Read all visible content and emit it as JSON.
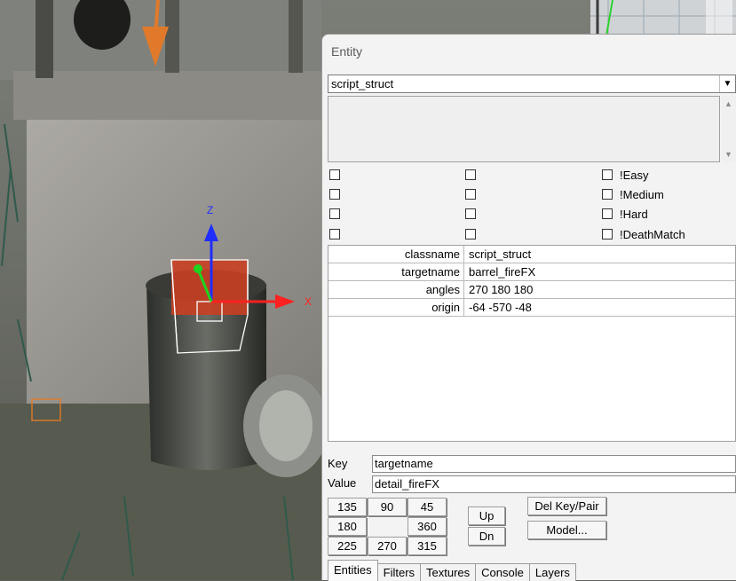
{
  "panel": {
    "title": "Entity",
    "class_select": {
      "value": "script_struct"
    },
    "flags": [
      {
        "label": ""
      },
      {
        "label": ""
      },
      {
        "label": "!Easy"
      },
      {
        "label": ""
      },
      {
        "label": ""
      },
      {
        "label": "!Medium"
      },
      {
        "label": ""
      },
      {
        "label": ""
      },
      {
        "label": "!Hard"
      },
      {
        "label": ""
      },
      {
        "label": ""
      },
      {
        "label": "!DeathMatch"
      }
    ],
    "properties": [
      {
        "key": "classname",
        "value": "script_struct"
      },
      {
        "key": "targetname",
        "value": "barrel_fireFX"
      },
      {
        "key": "angles",
        "value": "270 180 180"
      },
      {
        "key": "origin",
        "value": "-64 -570 -48"
      }
    ],
    "key_label": "Key",
    "key_value": "targetname",
    "value_label": "Value",
    "value_value": "detail_fireFX",
    "angle_buttons": [
      "135",
      "90",
      "45",
      "180",
      "360",
      "225",
      "270",
      "315"
    ],
    "up_label": "Up",
    "down_label": "Dn",
    "del_keypair_label": "Del Key/Pair",
    "model_label": "Model...",
    "tabs": [
      "Entities",
      "Filters",
      "Textures",
      "Console",
      "Layers"
    ]
  },
  "viewport": {
    "axis_x": "X",
    "axis_z": "Z"
  }
}
